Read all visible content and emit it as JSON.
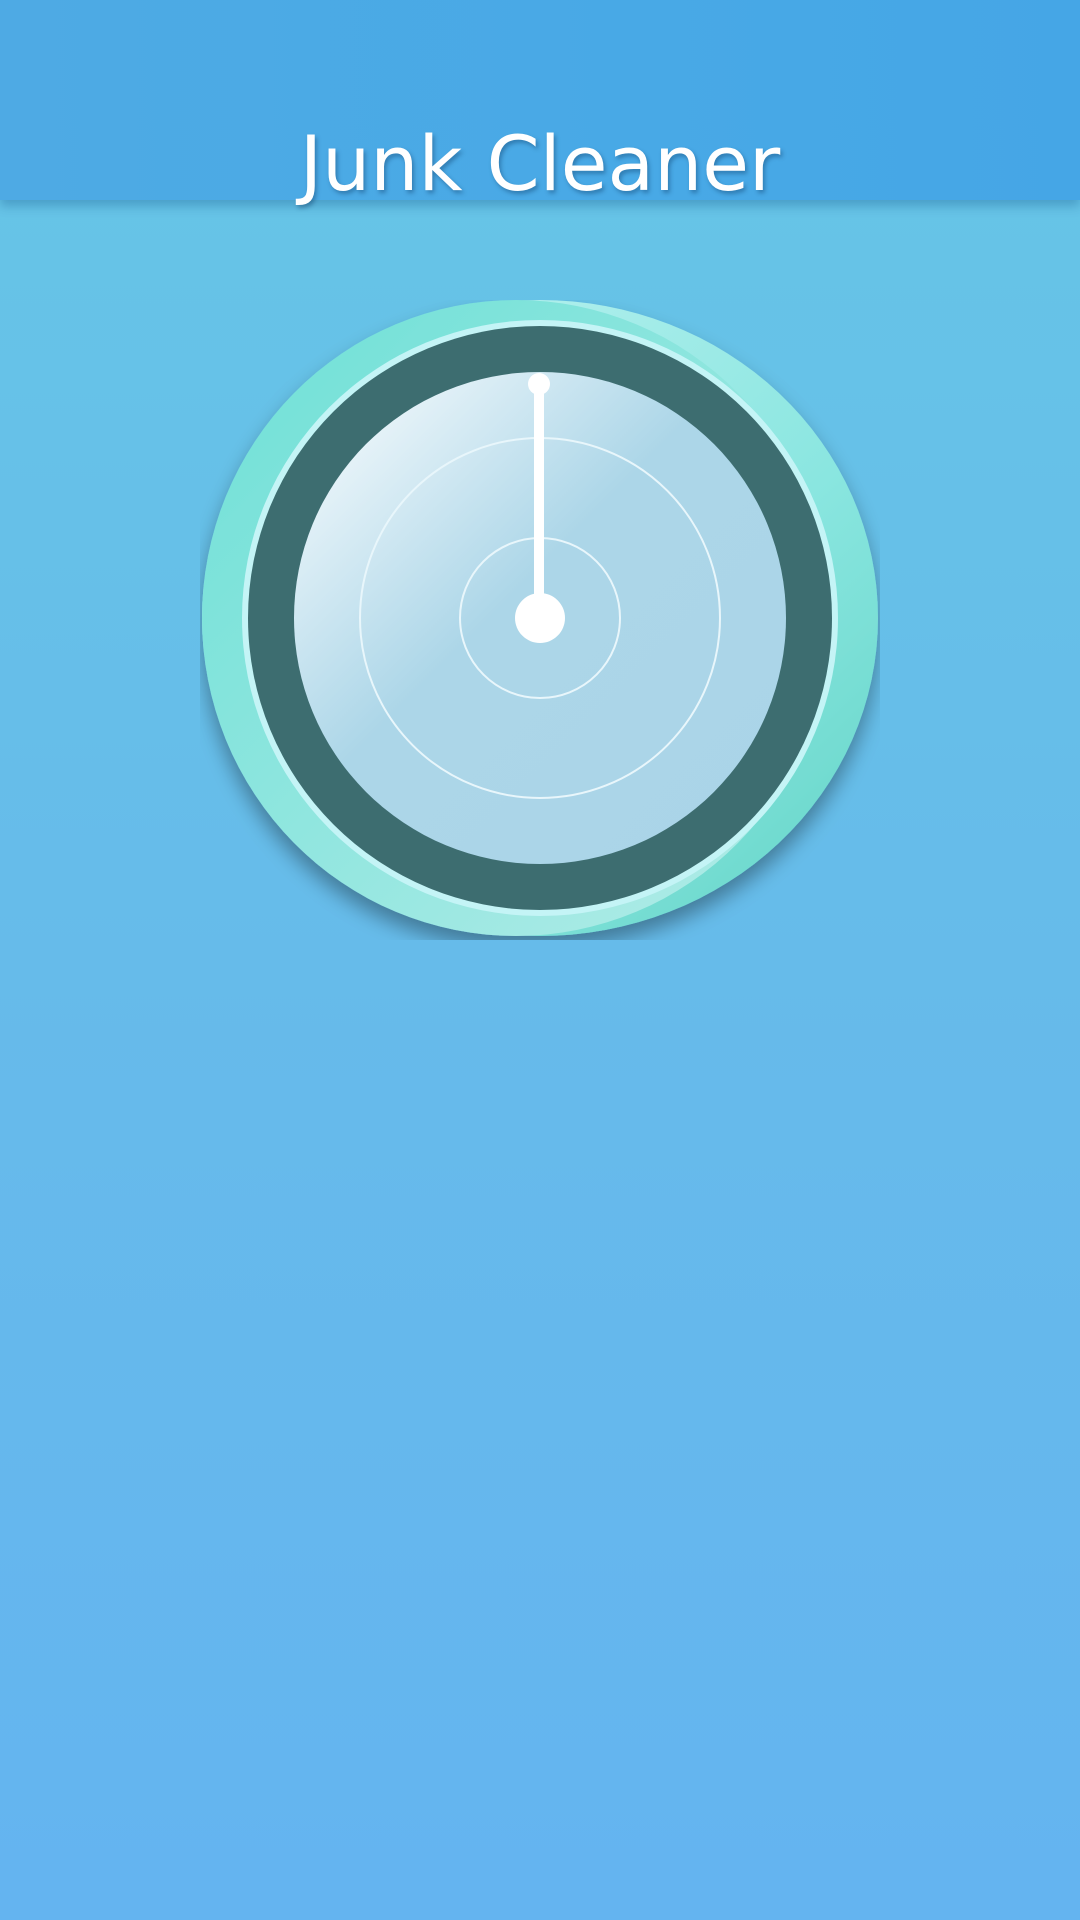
{
  "app_bar": {
    "title": "Junk Cleaner"
  },
  "gauge": {
    "needle_value_fraction": 0.0
  },
  "colors": {
    "header": "#48a9e6",
    "background_top": "#66c6e6",
    "background_bottom": "#64b4f0",
    "gauge_ring": "#3d6d70",
    "gauge_outer_teal": "#6fe0d8",
    "gauge_face": "#acd7e8",
    "needle": "#ffffff"
  }
}
